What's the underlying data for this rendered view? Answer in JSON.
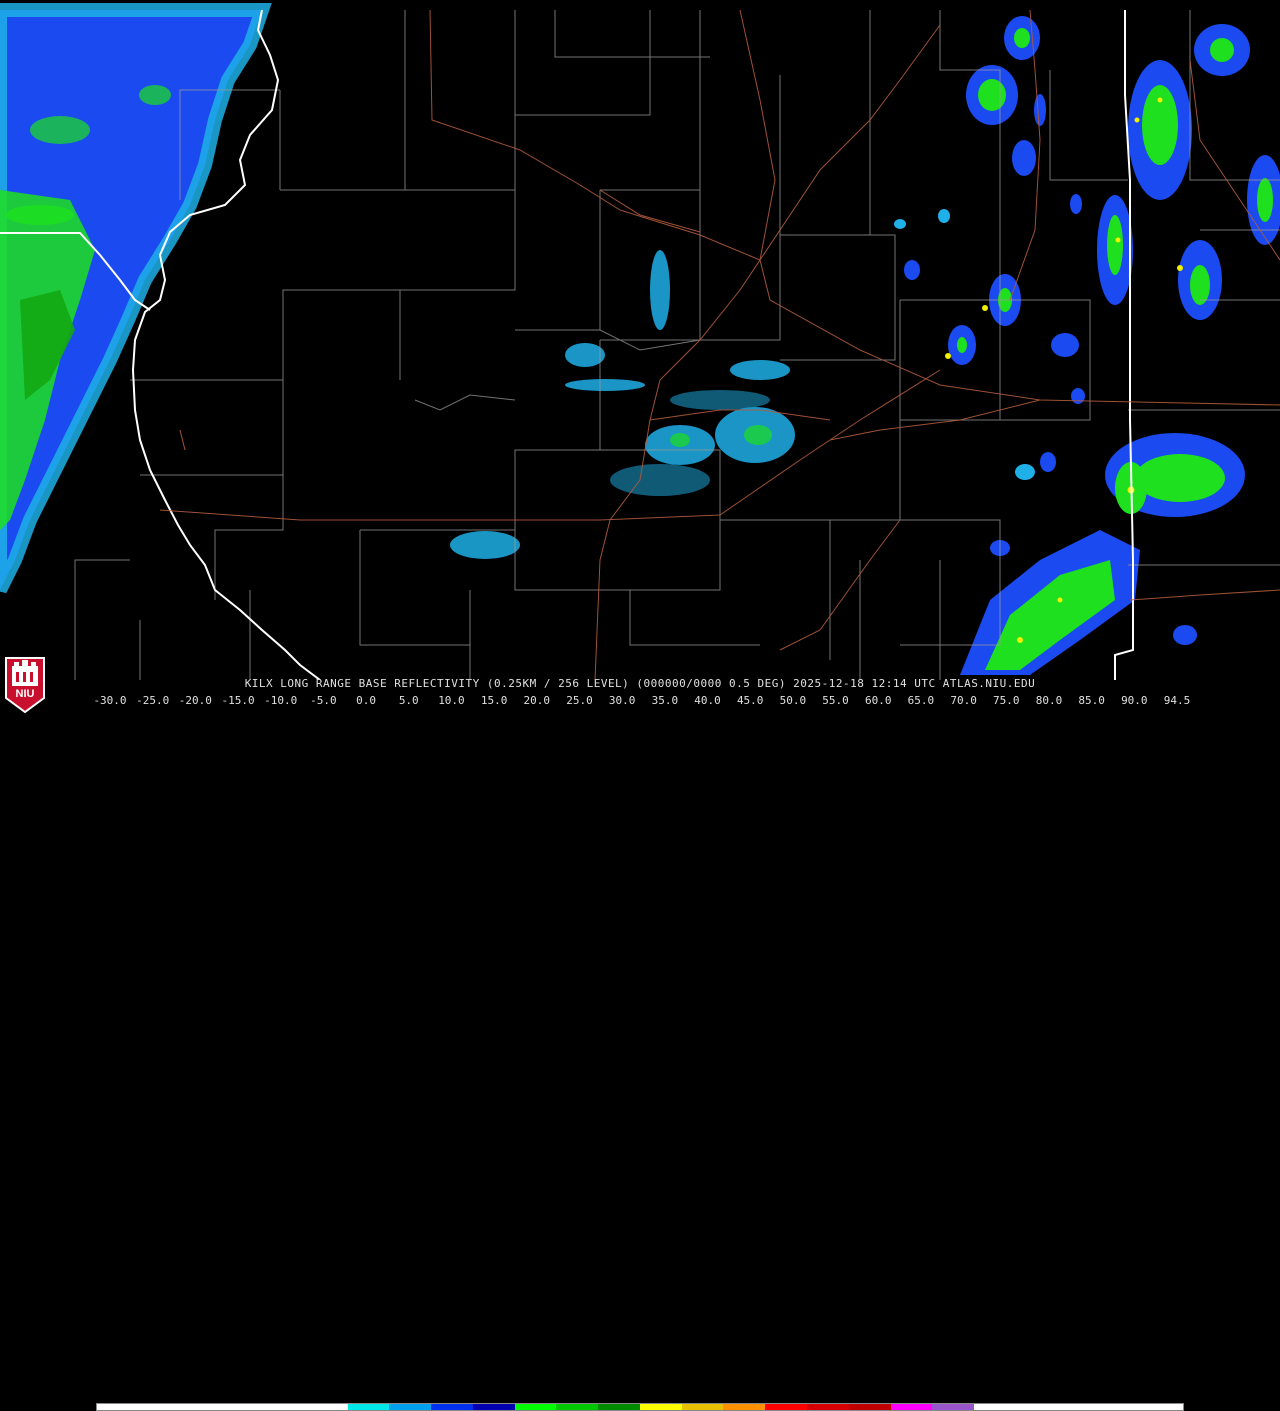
{
  "caption": "KILX LONG RANGE BASE REFLECTIVITY (0.25KM / 256 LEVEL) (000000/0000 0.5 DEG) 2025-12-18 12:14 UTC  ATLAS.NIU.EDU",
  "logo": {
    "text": "NIU",
    "color": "#c8102e"
  },
  "scale": {
    "ticks": [
      "-30.0",
      "-25.0",
      "-20.0",
      "-15.0",
      "-10.0",
      "-5.0",
      "0.0",
      "5.0",
      "10.0",
      "15.0",
      "20.0",
      "25.0",
      "30.0",
      "35.0",
      "40.0",
      "45.0",
      "50.0",
      "55.0",
      "60.0",
      "65.0",
      "70.0",
      "75.0",
      "80.0",
      "85.0",
      "90.0",
      "94.5"
    ],
    "colors": [
      "#ffffff",
      "#ffffff",
      "#ffffff",
      "#ffffff",
      "#ffffff",
      "#ffffff",
      "#00e8e8",
      "#00a0f0",
      "#0030f0",
      "#0000b0",
      "#00ff00",
      "#00c800",
      "#008c00",
      "#ffff00",
      "#e7c000",
      "#ff9000",
      "#ff0000",
      "#d60000",
      "#c00000",
      "#ff00ff",
      "#9955c9",
      "#ffffff",
      "#ffffff",
      "#ffffff",
      "#ffffff",
      "#ffffff"
    ]
  },
  "map_colors": {
    "state_border": "#ffffff",
    "county_line": "#9a9a9a",
    "highway": "#b05a3c",
    "echo_light": "#1fb0e8",
    "echo_blue": "#1a4af0",
    "echo_green": "#1ee01e",
    "echo_yellow": "#f0f000"
  }
}
